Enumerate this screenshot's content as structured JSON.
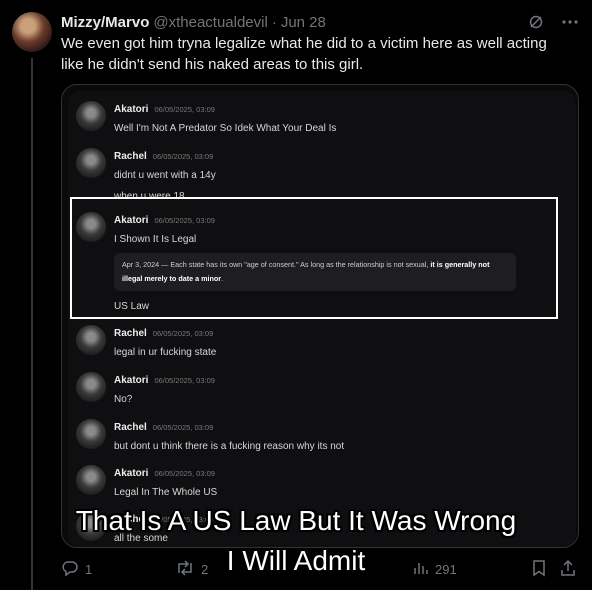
{
  "tweet": {
    "author_name": "Mizzy/Marvo",
    "handle": "@xtheactualdevil",
    "separator": "·",
    "date": "Jun 28",
    "text": "We even got him tryna legalize what he did to a victim here as well acting like he didn't send his naked areas to this girl."
  },
  "chat": {
    "messages": [
      {
        "author": "Akatori",
        "timestamp": "06/05/2025, 03:09",
        "lines": [
          "Well I'm Not A Predator So Idek What Your Deal Is"
        ]
      },
      {
        "author": "Rachel",
        "timestamp": "06/05/2025, 03:09",
        "lines": [
          "didnt u went with a 14y",
          "when u were 18"
        ]
      },
      {
        "author": "Akatori",
        "timestamp": "06/05/2025, 03:09",
        "lines": [
          "I Shown It Is Legal"
        ],
        "quote": {
          "date_prefix": "Apr 3, 2024 — ",
          "text": "Each state has its own \"age of consent.\" As long as the relationship is not sexual, ",
          "bold": "it is generally not illegal merely to date a minor",
          "suffix": "."
        },
        "after": "US Law"
      },
      {
        "author": "Rachel",
        "timestamp": "06/05/2025, 03:09",
        "lines": [
          "legal in ur fucking state"
        ]
      },
      {
        "author": "Akatori",
        "timestamp": "06/05/2025, 03:09",
        "lines": [
          "No?"
        ]
      },
      {
        "author": "Rachel",
        "timestamp": "06/05/2025, 03:09",
        "lines": [
          "but dont u think there is a fucking reason why its not"
        ]
      },
      {
        "author": "Akatori",
        "timestamp": "06/05/2025, 03:09",
        "lines": [
          "Legal In The Whole US"
        ]
      },
      {
        "author": "Rachel",
        "timestamp": "06/05/2025, 03:09",
        "lines": [
          "all the some"
        ]
      }
    ]
  },
  "caption": {
    "line1": "That Is A US Law But It Was Wrong",
    "line2": "I Will Admit"
  },
  "actions": {
    "replies": "1",
    "reposts": "2",
    "views": "291"
  },
  "icons": {
    "grok": "grok-icon",
    "more": "more-icon",
    "reply": "reply-icon",
    "repost": "repost-icon",
    "views": "views-icon",
    "bookmark": "bookmark-icon",
    "share": "share-icon"
  },
  "colors": {
    "background": "#000000",
    "text": "#e7e9ea",
    "muted": "#71767b",
    "highlight_box": "#ffffff"
  }
}
